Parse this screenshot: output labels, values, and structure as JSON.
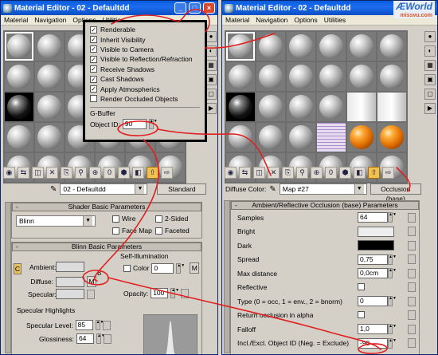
{
  "left": {
    "title": "Material Editor - 02 - Defaultdd",
    "menu": [
      "Material",
      "Navigation",
      "Options",
      "Utilities"
    ],
    "name_value": "02 - Defaultdd",
    "type_button": "Standard",
    "shader_rollup": "Shader Basic Parameters",
    "shader_value": "Blinn",
    "wire": "Wire",
    "two_sided": "2-Sided",
    "face_map": "Face Map",
    "faceted": "Faceted",
    "blinn_rollup": "Blinn Basic Parameters",
    "self_illum": "Self-Illumination",
    "color_label": "Color",
    "color_value": "0",
    "ambient": "Ambient:",
    "diffuse": "Diffuse:",
    "specular": "Specular:",
    "opacity": "Opacity:",
    "opacity_value": "100",
    "m_label": "M",
    "c_label": "C",
    "b_label": "B",
    "spec_highlights": "Specular Highlights",
    "spec_level": "Specular Level:",
    "spec_level_value": "85",
    "glossiness": "Glossiness:",
    "glossiness_value": "64"
  },
  "popup": {
    "items": [
      {
        "label": "Renderable",
        "checked": true
      },
      {
        "label": "Inherit Visibility",
        "checked": true
      },
      {
        "label": "Visible to Camera",
        "checked": true
      },
      {
        "label": "Visible to Reflection/Refraction",
        "checked": true
      },
      {
        "label": "Receive Shadows",
        "checked": true
      },
      {
        "label": "Cast Shadows",
        "checked": true
      },
      {
        "label": "Apply Atmospherics",
        "checked": true
      },
      {
        "label": "Render Occluded Objects",
        "checked": false
      }
    ],
    "gbuffer": "G-Buffer",
    "object_id_label": "Object ID:",
    "object_id_value": "90"
  },
  "right": {
    "title": "Material Editor - 02 - Defaultdd",
    "menu": [
      "Material",
      "Navigation",
      "Options",
      "Utilities"
    ],
    "diffuse_label": "Diffuse Color:",
    "map_value": "Map #27",
    "occlusion_button": "Occlusion (base)",
    "rollup": "Ambient/Reflective Occlusion (base) Parameters",
    "params": [
      {
        "label": "Samples",
        "value": "64"
      },
      {
        "label": "Bright",
        "value": ""
      },
      {
        "label": "Dark",
        "value": ""
      },
      {
        "label": "Spread",
        "value": "0,75"
      },
      {
        "label": "Max distance",
        "value": "0,0cm"
      },
      {
        "label": "Reflective",
        "value": ""
      },
      {
        "label": "Type (0 = occ, 1 = env., 2 = bnorm)",
        "value": "0"
      },
      {
        "label": "Return occlusion in alpha",
        "value": ""
      },
      {
        "label": "Falloff",
        "value": "1,0"
      },
      {
        "label": "Incl./Excl. Object ID (Neg. = Exclude)",
        "value": "-90"
      }
    ]
  },
  "watermark": {
    "main": "ÆWorld",
    "sub": "missvu.com"
  },
  "colors": {
    "annotation": "#e02020",
    "title_blue": "#0a5cdb",
    "highlight": "#f0c050"
  }
}
